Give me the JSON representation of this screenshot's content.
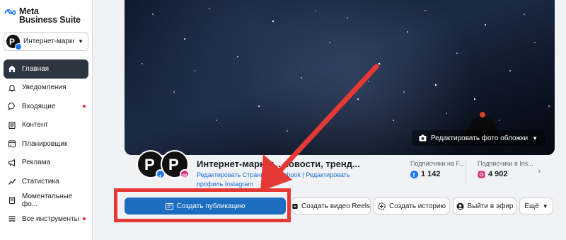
{
  "brand": {
    "line1": "Meta",
    "line2": "Business Suite"
  },
  "account": {
    "name": "Интернет-марке..."
  },
  "nav": [
    {
      "label": "Главная",
      "icon": "home-icon",
      "active": true,
      "dot": false
    },
    {
      "label": "Уведомления",
      "icon": "bell-icon",
      "active": false,
      "dot": false
    },
    {
      "label": "Входящие",
      "icon": "chat-icon",
      "active": false,
      "dot": true
    },
    {
      "label": "Контент",
      "icon": "content-icon",
      "active": false,
      "dot": false
    },
    {
      "label": "Планировщик",
      "icon": "calendar-icon",
      "active": false,
      "dot": false
    },
    {
      "label": "Реклама",
      "icon": "megaphone-icon",
      "active": false,
      "dot": false
    },
    {
      "label": "Статистика",
      "icon": "chart-icon",
      "active": false,
      "dot": false
    },
    {
      "label": "Моментальные фо...",
      "icon": "form-icon",
      "active": false,
      "dot": false
    },
    {
      "label": "Все инструменты",
      "icon": "menu-icon",
      "active": false,
      "dot": true
    }
  ],
  "cover": {
    "edit_label": "Редактировать фото обложки"
  },
  "profile": {
    "name": "Интернет-маркет... новости, тренд...",
    "link_facebook": "Редактировать Страницу Facebook",
    "separator": " | ",
    "link_instagram": "Редактировать профиль Instagram"
  },
  "stats": {
    "fb_label": "Подписчики на F...",
    "fb_value": "1 142",
    "ig_label": "Подписчики в Ins...",
    "ig_value": "4 902"
  },
  "actions": {
    "create_post": "Создать публикацию",
    "create_reel": "Создать видео Reels",
    "create_story": "Создать историю",
    "go_live": "Выйти в эфир",
    "more": "Ещё"
  },
  "colors": {
    "primary": "#1d6dc2",
    "sidebar_active": "#2d3541",
    "annotation_red": "#e53935",
    "facebook_blue": "#1877f2",
    "instagram_pink": "#d62976"
  }
}
